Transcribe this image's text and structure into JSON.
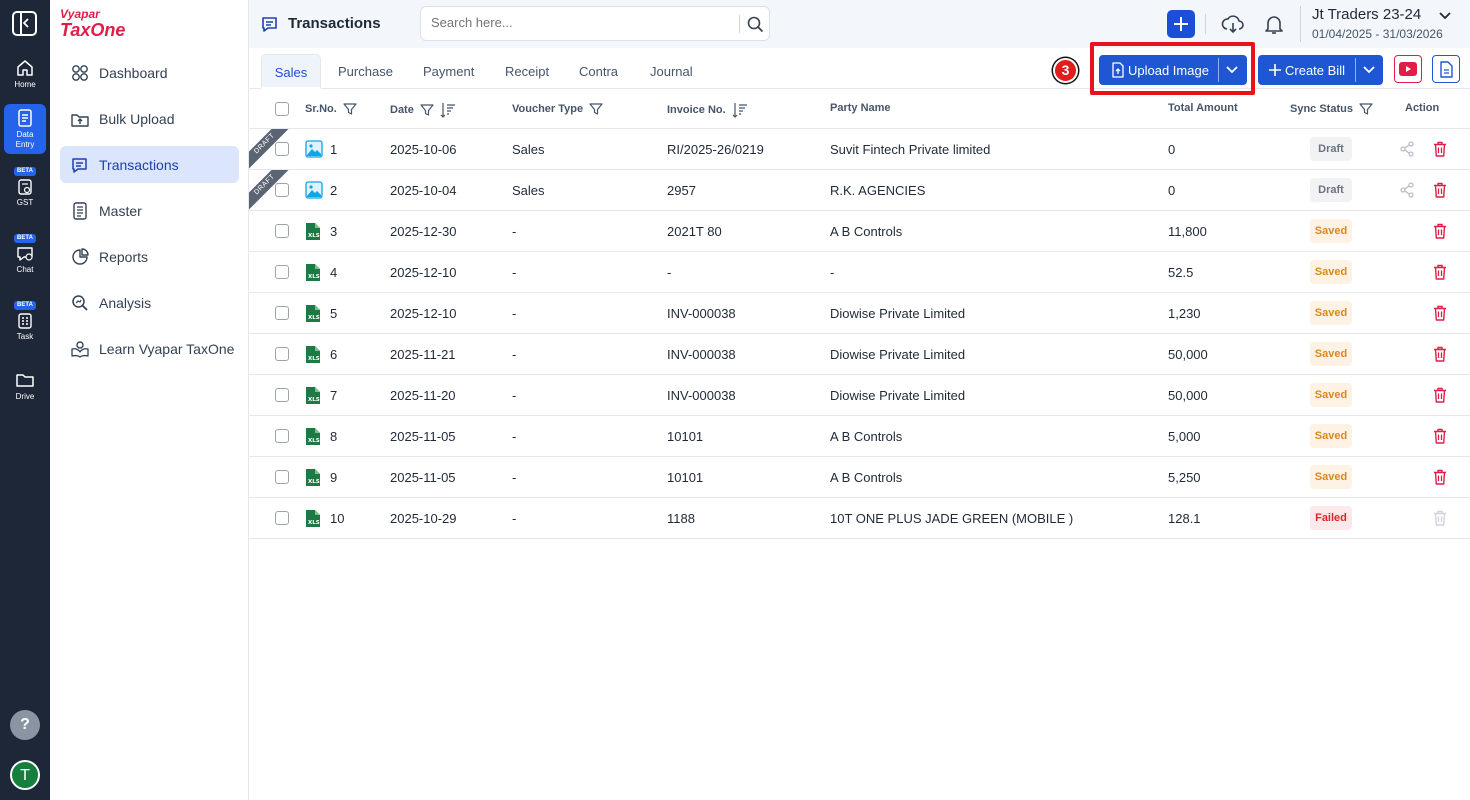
{
  "brand": {
    "top": "Vyapar",
    "main": "TaxOne"
  },
  "rail": {
    "items": [
      {
        "label": "Home",
        "icon": "home-icon"
      },
      {
        "label": "Data Entry",
        "icon": "data-entry-icon"
      },
      {
        "label": "GST",
        "icon": "gst-icon",
        "badge": "BETA"
      },
      {
        "label": "Chat",
        "icon": "chat-icon",
        "badge": "BETA"
      },
      {
        "label": "Task",
        "icon": "task-icon",
        "badge": "BETA"
      },
      {
        "label": "Drive",
        "icon": "folder-icon"
      }
    ],
    "help": "?",
    "avatar": "T"
  },
  "sidebar": {
    "items": [
      {
        "label": "Dashboard",
        "icon": "dashboard-icon"
      },
      {
        "label": "Bulk Upload",
        "icon": "bulk-upload-icon"
      },
      {
        "label": "Transactions",
        "icon": "transactions-icon"
      },
      {
        "label": "Master",
        "icon": "master-icon"
      },
      {
        "label": "Reports",
        "icon": "reports-icon"
      },
      {
        "label": "Analysis",
        "icon": "analysis-icon"
      },
      {
        "label": "Learn Vyapar TaxOne",
        "icon": "learn-icon"
      }
    ]
  },
  "header": {
    "title": "Transactions",
    "search_placeholder": "Search here...",
    "company": "Jt Traders 23-24",
    "financial_year": "01/04/2025 - 31/03/2026"
  },
  "tabs": [
    "Sales",
    "Purchase",
    "Payment",
    "Receipt",
    "Contra",
    "Journal"
  ],
  "toolbar": {
    "step_badge": "3",
    "upload_label": "Upload Image",
    "create_label": "Create Bill"
  },
  "table": {
    "columns": [
      "Sr.No.",
      "Date",
      "Voucher Type",
      "Invoice No.",
      "Party Name",
      "Total Amount",
      "Sync Status",
      "Action"
    ],
    "rows": [
      {
        "sr": "1",
        "date": "2025-10-06",
        "voucher": "Sales",
        "invoice": "RI/2025-26/0219",
        "party": "Suvit Fintech Private limited",
        "amount": "0",
        "status": "Draft",
        "file": "image",
        "ribbon": "DRAFT"
      },
      {
        "sr": "2",
        "date": "2025-10-04",
        "voucher": "Sales",
        "invoice": "2957",
        "party": "R.K. AGENCIES",
        "amount": "0",
        "status": "Draft",
        "file": "image",
        "ribbon": "DRAFT"
      },
      {
        "sr": "3",
        "date": "2025-12-30",
        "voucher": "-",
        "invoice": "2021T 80",
        "party": "A B Controls",
        "amount": "11,800",
        "status": "Saved",
        "file": "xls"
      },
      {
        "sr": "4",
        "date": "2025-12-10",
        "voucher": "-",
        "invoice": "-",
        "party": "-",
        "amount": "52.5",
        "status": "Saved",
        "file": "xls"
      },
      {
        "sr": "5",
        "date": "2025-12-10",
        "voucher": "-",
        "invoice": "INV-000038",
        "party": "Diowise Private Limited",
        "amount": "1,230",
        "status": "Saved",
        "file": "xls"
      },
      {
        "sr": "6",
        "date": "2025-11-21",
        "voucher": "-",
        "invoice": "INV-000038",
        "party": "Diowise Private Limited",
        "amount": "50,000",
        "status": "Saved",
        "file": "xls"
      },
      {
        "sr": "7",
        "date": "2025-11-20",
        "voucher": "-",
        "invoice": "INV-000038",
        "party": "Diowise Private Limited",
        "amount": "50,000",
        "status": "Saved",
        "file": "xls"
      },
      {
        "sr": "8",
        "date": "2025-11-05",
        "voucher": "-",
        "invoice": "10101",
        "party": "A B Controls",
        "amount": "5,000",
        "status": "Saved",
        "file": "xls"
      },
      {
        "sr": "9",
        "date": "2025-11-05",
        "voucher": "-",
        "invoice": "10101",
        "party": "A B Controls",
        "amount": "5,250",
        "status": "Saved",
        "file": "xls"
      },
      {
        "sr": "10",
        "date": "2025-10-29",
        "voucher": "-",
        "invoice": "1188",
        "party": "10T ONE PLUS JADE GREEN (MOBILE )",
        "amount": "128.1",
        "status": "Failed",
        "file": "xls"
      }
    ]
  },
  "colors": {
    "accent": "#1e56d4",
    "rail": "#1d2738",
    "highlight": "#e8131a",
    "brand": "#e11d48"
  }
}
